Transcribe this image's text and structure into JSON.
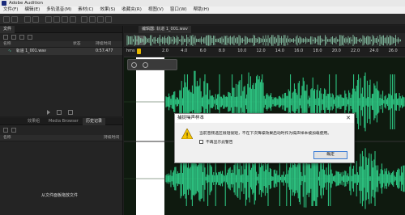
{
  "window": {
    "title": "Adobe Audition"
  },
  "menu": [
    "文件(F)",
    "编辑(E)",
    "多轨混音(M)",
    "素材(C)",
    "效果(S)",
    "收藏夹(R)",
    "视图(V)",
    "窗口(W)",
    "帮助(H)"
  ],
  "files_panel": {
    "tab_label": "文件",
    "columns": [
      "名称",
      "状态",
      "持续时间"
    ],
    "row": {
      "name": "轨道 1_001.wav",
      "duration": "0:57.477"
    }
  },
  "effects_panel": {
    "tabs": [
      "效果组",
      "Media Browser",
      "历史记录"
    ],
    "columns": [
      "名称",
      "持续时间"
    ],
    "drop_hint": "从文件面板拖放文件"
  },
  "editor": {
    "tab_label": "编辑器: 轨道 1_001.wav",
    "time_unit": "hms",
    "ticks": [
      "2.0",
      "4.0",
      "6.0",
      "8.0",
      "10.0",
      "12.0",
      "14.0",
      "16.0",
      "18.0",
      "20.0",
      "22.0",
      "24.0",
      "26.0",
      "28.0"
    ],
    "playhead_label": "2.0"
  },
  "dialog": {
    "title": "捕捉噪声样本",
    "message": "当前音频选区很短很短，不在下次降噪效果启动时作为噪声样本被加载使用。",
    "checkbox_label": "不再显示此警告",
    "ok_label": "确定"
  },
  "colors": {
    "waveform": "#2fd18a",
    "accent": "#e6b800"
  }
}
